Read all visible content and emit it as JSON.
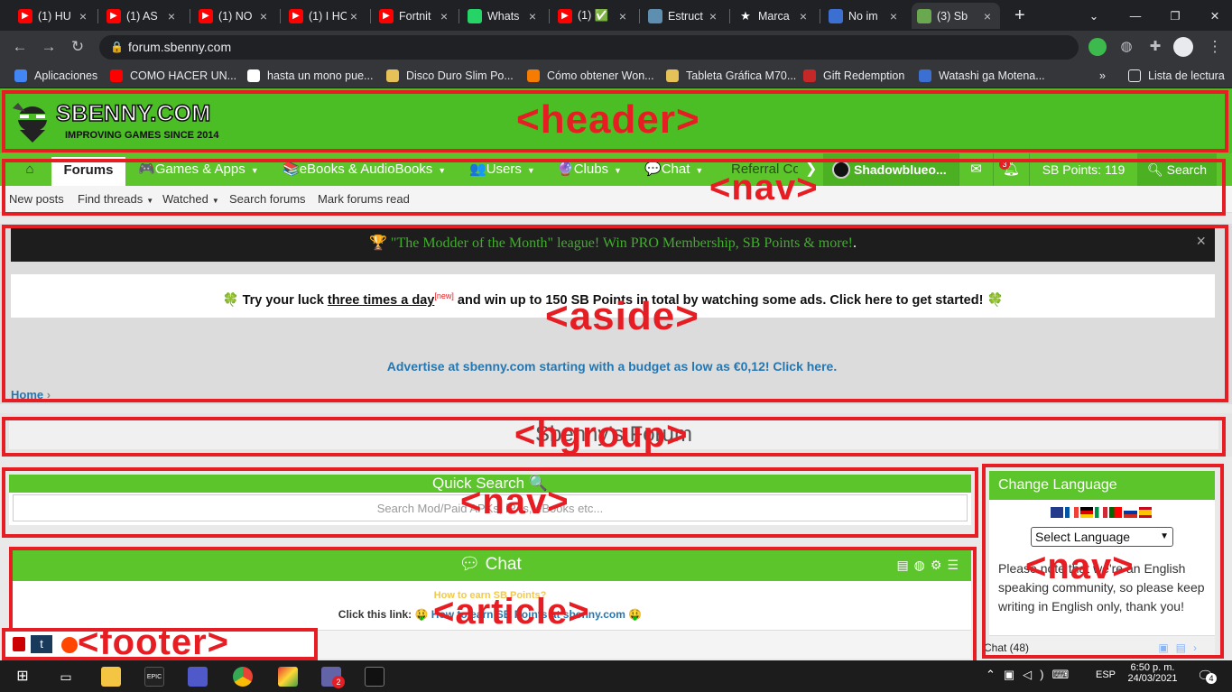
{
  "browser": {
    "tabs": [
      {
        "title": "(1) HU",
        "icon": "youtube",
        "color": "#ff0000"
      },
      {
        "title": "(1) AS",
        "icon": "youtube",
        "color": "#ff0000"
      },
      {
        "title": "(1) NO",
        "icon": "youtube",
        "color": "#ff0000"
      },
      {
        "title": "(1) I HO",
        "icon": "youtube",
        "color": "#ff0000"
      },
      {
        "title": "Fortnit",
        "icon": "youtube",
        "color": "#ff0000"
      },
      {
        "title": "Whats",
        "icon": "whatsapp",
        "color": "#25d366"
      },
      {
        "title": "(1) ✅",
        "icon": "youtube",
        "color": "#ff0000"
      },
      {
        "title": "Estruct",
        "icon": "site",
        "color": "#5f8fb0"
      },
      {
        "title": "Marca",
        "icon": "star",
        "color": "#202124"
      },
      {
        "title": "No im",
        "icon": "site",
        "color": "#3b6fd1"
      },
      {
        "title": "(3) Sb",
        "icon": "sbenny",
        "color": "#6aa84f"
      }
    ],
    "new_tab": "+",
    "url": "forum.sbenny.com",
    "bookmarks": [
      {
        "label": "Aplicaciones",
        "color": "#4285f4"
      },
      {
        "label": "COMO HACER UN...",
        "color": "#ff0000"
      },
      {
        "label": "hasta un mono pue...",
        "color": "#ffffff"
      },
      {
        "label": "Disco Duro Slim Po...",
        "color": "#e5c158"
      },
      {
        "label": "Cómo obtener Won...",
        "color": "#f57c00"
      },
      {
        "label": "Tableta Gráfica M70...",
        "color": "#e5c158"
      },
      {
        "label": "Gift Redemption",
        "color": "#c62828"
      },
      {
        "label": "Watashi ga Motena...",
        "color": "#3b6fd1"
      }
    ],
    "bookmarks_more": "»",
    "reading_list": "Lista de lectura"
  },
  "site": {
    "logo_text": "SBENNY.COM",
    "logo_tagline": "IMPROVING GAMES SINCE 2014",
    "nav": [
      {
        "label": "Forums",
        "icon": "",
        "dropdown": false,
        "active": true
      },
      {
        "label": "Games & Apps",
        "icon": "🎮",
        "dropdown": true
      },
      {
        "label": "eBooks & AudioBooks",
        "icon": "📚",
        "dropdown": true
      },
      {
        "label": "Users",
        "icon": "👥",
        "dropdown": true
      },
      {
        "label": "Clubs",
        "icon": "🔮",
        "dropdown": true
      },
      {
        "label": "Chat",
        "icon": "💬",
        "dropdown": true
      },
      {
        "label": "Referral Co",
        "icon": "",
        "dropdown": false
      }
    ],
    "username": "Shadowblueo...",
    "notif_count": "3",
    "sb_points": "SB Points: 119",
    "search_label": "Search",
    "subnav": [
      "New posts",
      "Find threads",
      "Watched",
      "Search forums",
      "Mark forums read"
    ],
    "notice_text": "\"The Modder of the Month\" league! Win PRO Membership, SB Points & more!",
    "notice_period": ".",
    "promo_pre": "Try your luck ",
    "promo_link": "three times a day",
    "promo_new": "[new]",
    "promo_post": " and win up to 150 SB Points in total by watching some ads. Click here to get started!",
    "advertise": "Advertise at sbenny.com starting with a budget as low as €0,12! Click here.",
    "breadcrumb_home": "Home",
    "forum_title": "Sbenny's Forum",
    "quick_search_title": "Quick Search 🔍",
    "quick_search_placeholder": "Search Mod/Paid APKs, iPAs, eBooks etc...",
    "chat_title": "Chat",
    "chat_earn": "How to earn SB Points?",
    "chat_click": "Click this link:",
    "chat_link": "How to earn SB Points at sbenny.com",
    "chat_count": "Chat (48)",
    "lang_title": "Change Language",
    "lang_select": "Select Language",
    "lang_note": "Please note that we're an English speaking community, so please keep writing in English only, thank you!"
  },
  "annotations": [
    "<header>",
    "<nav>",
    "<aside>",
    "<hgroup>",
    "<nav>",
    "<article>",
    "<footer>",
    "<nav>"
  ],
  "taskbar": {
    "lang": "ESP",
    "time": "6:50 p. m.",
    "date": "24/03/2021",
    "notif": "4",
    "badge": "2"
  }
}
